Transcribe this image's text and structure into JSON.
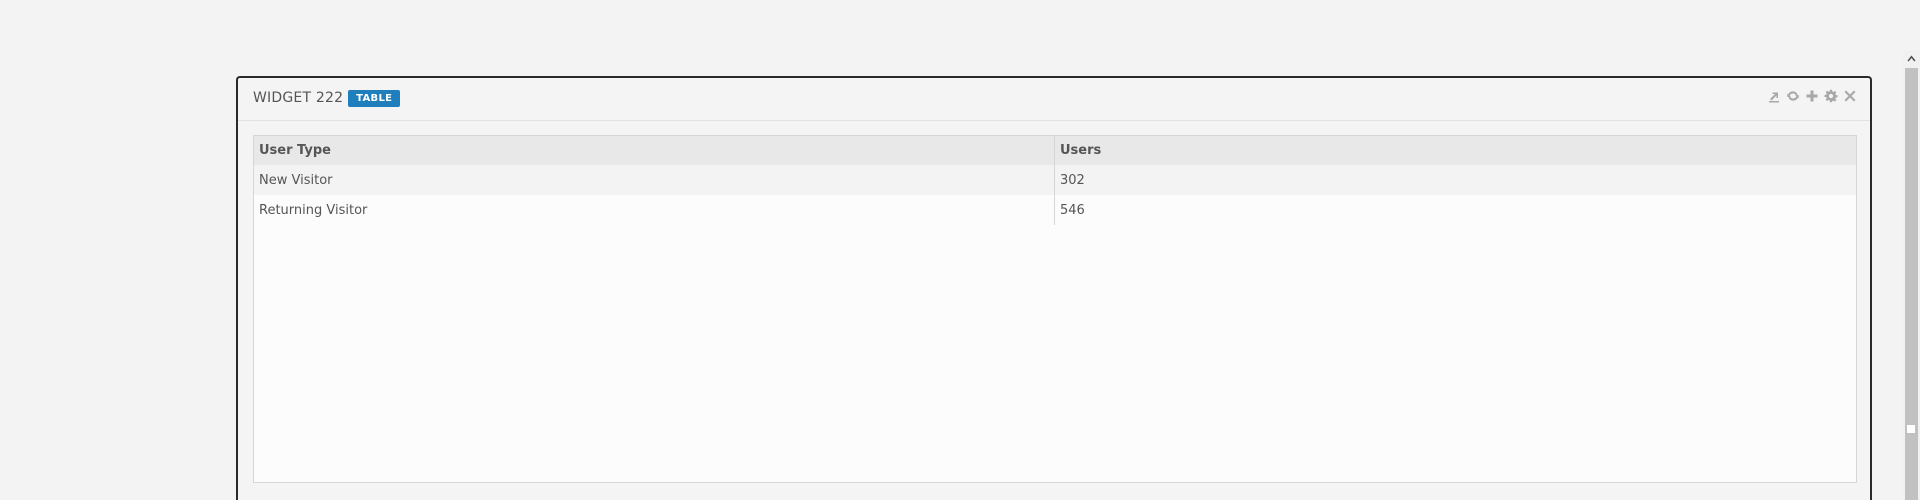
{
  "widget": {
    "title": "WIDGET 222",
    "badge": "TABLE",
    "toolbar": {
      "icons": [
        "export-icon",
        "refresh-icon",
        "plus-icon",
        "gear-icon",
        "close-icon"
      ]
    }
  },
  "table": {
    "columns": [
      "User Type",
      "Users"
    ],
    "rows": [
      [
        "New Visitor",
        "302"
      ],
      [
        "Returning Visitor",
        "546"
      ]
    ]
  },
  "colors": {
    "badge": "#1f7fbd",
    "background": "#f3f3f3",
    "icon": "#a8a8a8"
  }
}
